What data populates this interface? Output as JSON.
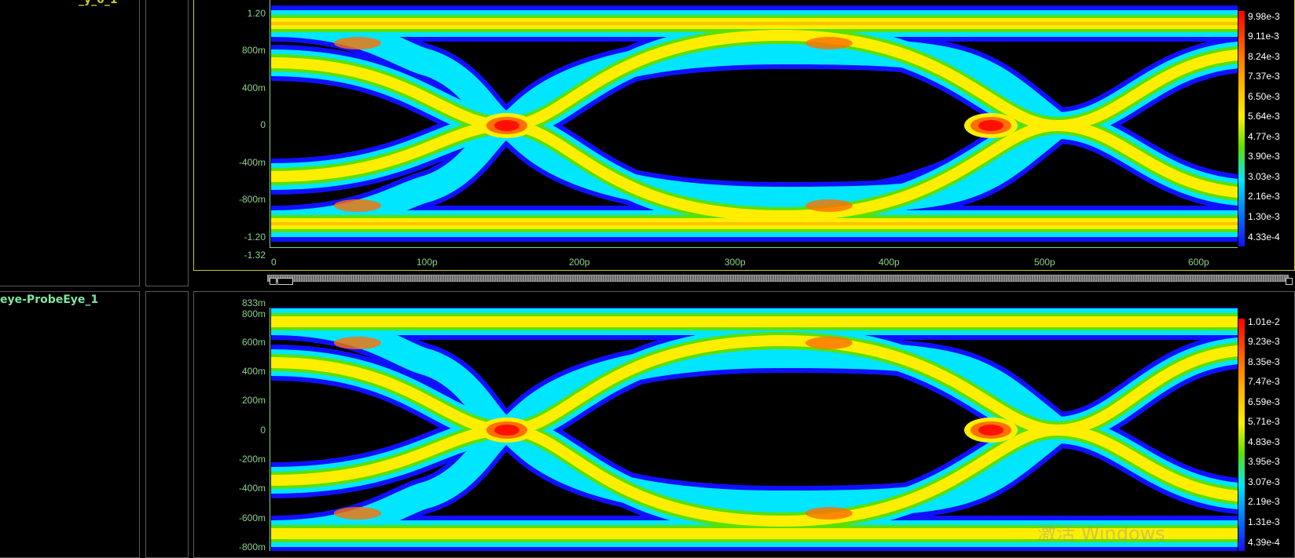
{
  "panels": [
    {
      "name": "",
      "name_visible_suffix": "_y_0_1",
      "y_ticks": [
        "1.20",
        "800m",
        "400m",
        "0",
        "-400m",
        "-800m",
        "-1.20",
        "-1.32"
      ],
      "x_ticks": [
        "0",
        "100p",
        "200p",
        "300p",
        "400p",
        "500p",
        "600p"
      ],
      "colorbar": [
        "9.98e-3",
        "9.11e-3",
        "8.24e-3",
        "7.37e-3",
        "6.50e-3",
        "5.64e-3",
        "4.77e-3",
        "3.90e-3",
        "3.03e-3",
        "2.16e-3",
        "1.30e-3",
        "4.33e-4"
      ]
    },
    {
      "name": "eye-ProbeEye_1",
      "y_ticks": [
        "833m",
        "800m",
        "600m",
        "400m",
        "200m",
        "0",
        "-200m",
        "-400m",
        "-600m",
        "-800m"
      ],
      "x_ticks": [],
      "colorbar": [
        "1.01e-2",
        "9.23e-3",
        "8.35e-3",
        "7.47e-3",
        "6.59e-3",
        "5.71e-3",
        "4.83e-3",
        "3.95e-3",
        "3.07e-3",
        "2.19e-3",
        "1.31e-3",
        "4.39e-4"
      ]
    }
  ],
  "watermark": {
    "line1": "激活 Windows"
  },
  "colors": {
    "accent": "#c9c92a",
    "label": "#7ee6a0",
    "grid": "#5a5a5a"
  }
}
